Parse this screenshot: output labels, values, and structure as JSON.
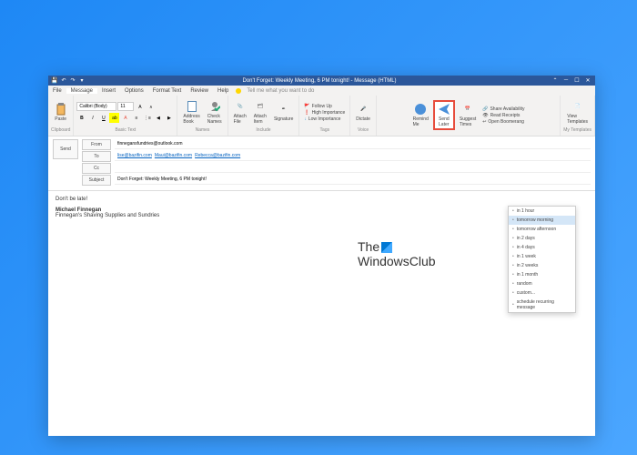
{
  "titlebar": {
    "title": "Don't Forget: Weekly Meeting, 6 PM tonight! - Message (HTML)"
  },
  "menu": {
    "items": [
      "File",
      "Message",
      "Insert",
      "Options",
      "Format Text",
      "Review",
      "Help"
    ],
    "tellme": "Tell me what you want to do"
  },
  "ribbon": {
    "clipboard": {
      "label": "Clipboard",
      "paste": "Paste"
    },
    "font": {
      "label": "Basic Text",
      "family": "Calibri (Body)",
      "size": "11"
    },
    "names": {
      "label": "Names",
      "address": "Address\nBook",
      "check": "Check\nNames"
    },
    "include": {
      "label": "Include",
      "attachfile": "Attach\nFile",
      "attachitem": "Attach\nItem",
      "signature": "Signature"
    },
    "tags": {
      "label": "Tags",
      "followup": "Follow Up",
      "high": "High Importance",
      "low": "Low Importance"
    },
    "voice": {
      "label": "Voice",
      "dictate": "Dictate"
    },
    "boomerang": {
      "remind": "Remind\nMe",
      "sendlater": "Send\nLater",
      "suggest": "Suggest\nTimes",
      "share": "Share Availability",
      "receipts": "Read Receipts",
      "open": "Open Boomerang"
    },
    "templates": {
      "label": "My Templates",
      "view": "View\nTemplates"
    }
  },
  "addr": {
    "send": "Send",
    "from": "From",
    "to": "To",
    "cc": "Cc",
    "subject": "Subject",
    "fromval": "finnegansfundries@outlook.com",
    "toval": [
      "lise@bazifin.com",
      "Maui@bazifin.com",
      "Rebecca@bazifin.com"
    ],
    "subjectval": "Don't Forget: Weekly Meeting, 6 PM tonight!"
  },
  "body": {
    "line1": "Don't be late!",
    "sig1": "Michael Finnegan",
    "sig2": "Finnegan's Shaving Supplies and Sundries"
  },
  "dropdown": {
    "items": [
      "in 1 hour",
      "tomorrow morning",
      "tomorrow afternoon",
      "in 2 days",
      "in 4 days",
      "in 1 week",
      "in 2 weeks",
      "in 1 month",
      "random",
      "custom...",
      "schedule recurring message"
    ]
  },
  "watermark": {
    "l1": "The",
    "l2": "WindowsClub"
  }
}
